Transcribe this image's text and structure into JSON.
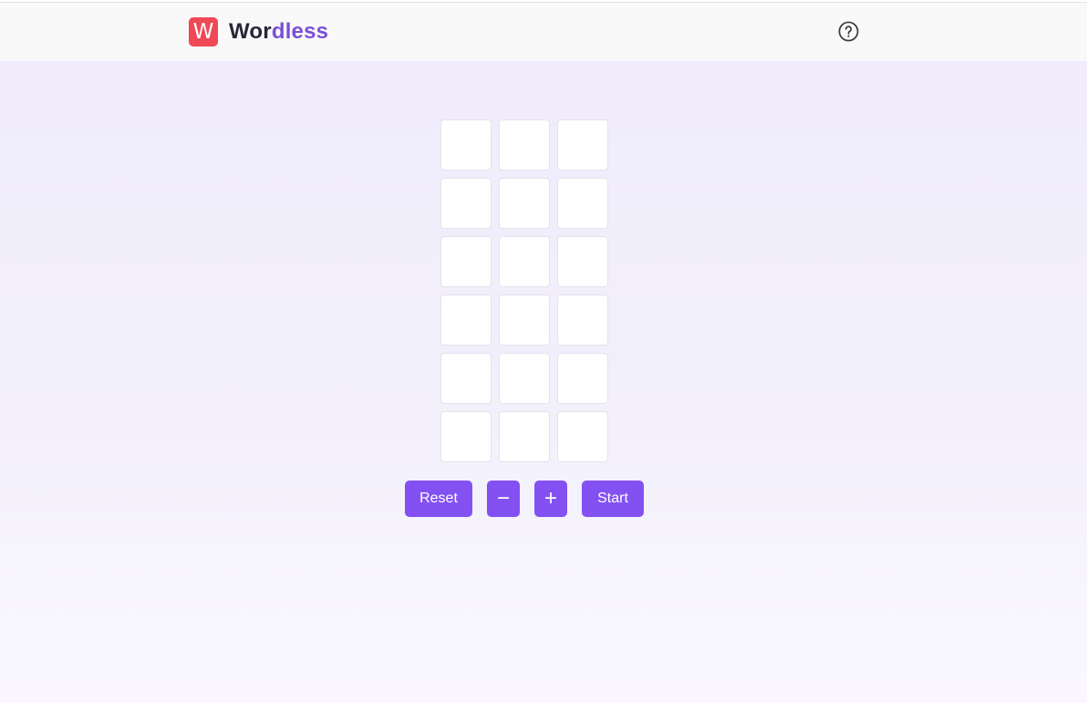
{
  "header": {
    "logo_letter": "W",
    "brand_part1": "Wor",
    "brand_part2": "dless",
    "help_icon": "question-circle-icon"
  },
  "board": {
    "columns": 3,
    "rows": 6,
    "tiles": [
      "",
      "",
      "",
      "",
      "",
      "",
      "",
      "",
      "",
      "",
      "",
      "",
      "",
      "",
      "",
      "",
      "",
      ""
    ]
  },
  "controls": {
    "reset_label": "Reset",
    "decrease_label": "−",
    "increase_label": "+",
    "start_label": "Start"
  },
  "colors": {
    "accent": "#8351f2",
    "logo_bg": "#ef4856",
    "brand_dark": "#2b2538",
    "brand_purple": "#7a4fd6"
  }
}
